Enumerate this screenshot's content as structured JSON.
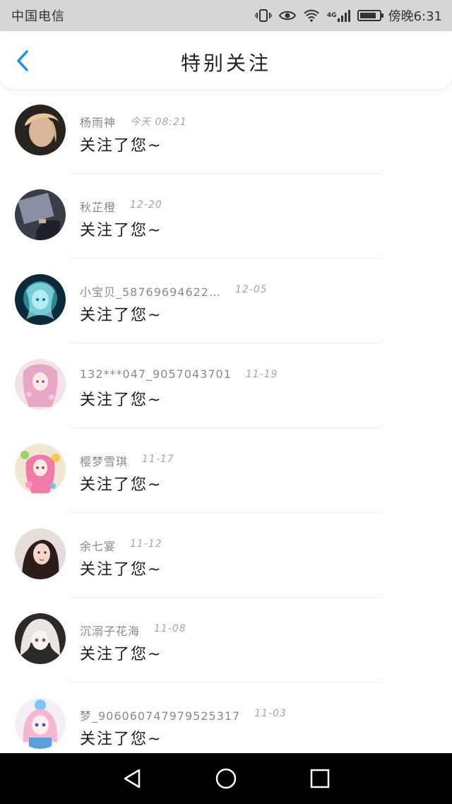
{
  "status_bar": {
    "carrier": "中国电信",
    "network": "4G",
    "time": "傍晚6:31"
  },
  "header": {
    "title": "特别关注"
  },
  "items": [
    {
      "name": "杨雨神",
      "date": "今天 08:21",
      "message": "关注了您~"
    },
    {
      "name": "秋芷橙",
      "date": "12-20",
      "message": "关注了您~"
    },
    {
      "name": "小宝贝_58769694622…",
      "date": "12-05",
      "message": "关注了您~"
    },
    {
      "name": "132***047_9057043701",
      "date": "11-19",
      "message": "关注了您~"
    },
    {
      "name": "樱梦雪琪",
      "date": "11-17",
      "message": "关注了您~"
    },
    {
      "name": "余七宴",
      "date": "11-12",
      "message": "关注了您~"
    },
    {
      "name": "沉溺子花海",
      "date": "11-08",
      "message": "关注了您~"
    },
    {
      "name": "梦_9060607479795253​17",
      "date": "11-03",
      "message": "关注了您~"
    }
  ],
  "colors": {
    "accent": "#1a8cff",
    "status_bar_bg": "#d6d6d6",
    "nav_bar_bg": "#000000"
  },
  "icons": {
    "back": "chevron-left-icon",
    "nav_back": "triangle-back-icon",
    "nav_home": "circle-home-icon",
    "nav_recent": "square-recent-icon"
  }
}
